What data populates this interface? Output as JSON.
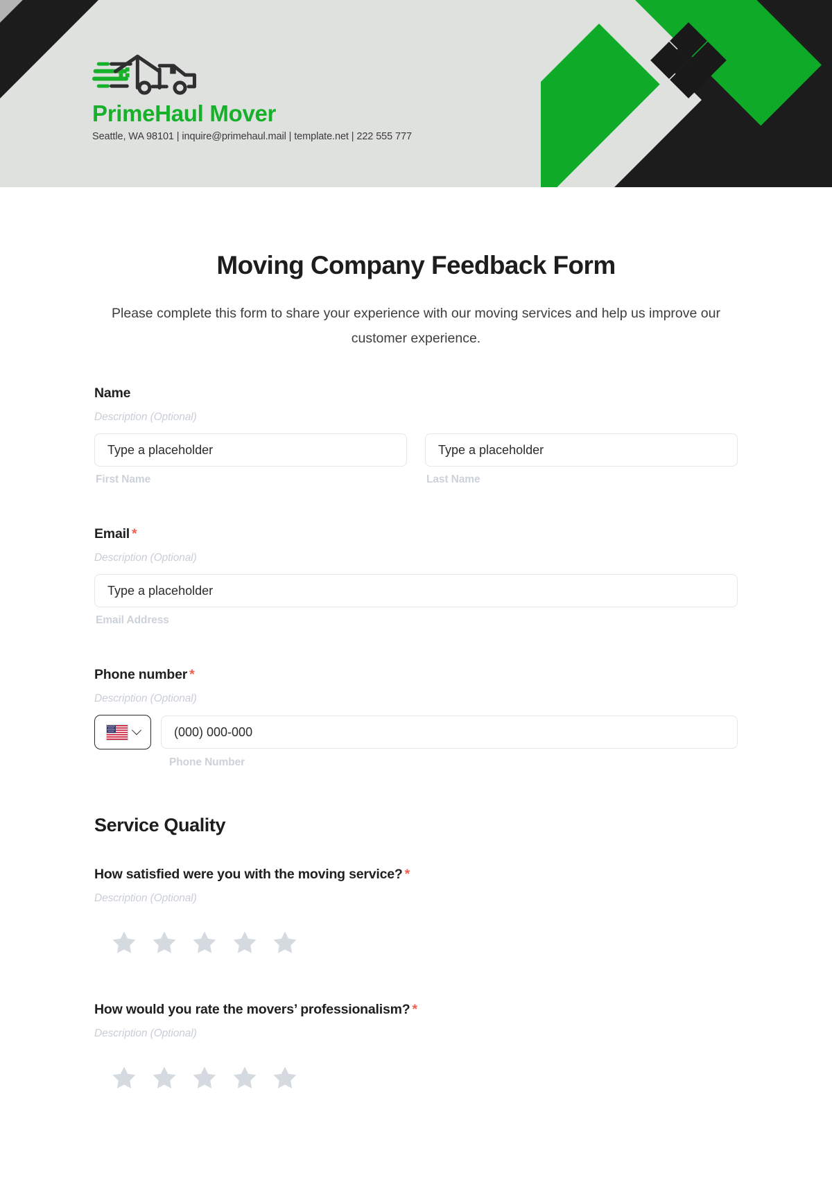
{
  "header": {
    "brand_name": "PrimeHaul Mover",
    "contact_line": "Seattle, WA 98101 | inquire@primehaul.mail | template.net | 222 555 777",
    "logo_icon": "moving-truck-icon",
    "accent_green": "#0fab28",
    "dark": "#1c1c1c",
    "banner_bg": "#dfe1df"
  },
  "form": {
    "title": "Moving Company Feedback Form",
    "subtitle": "Please complete this form to share your experience with our moving services and help us improve our customer experience.",
    "required_marker": "*",
    "description_placeholder": "Description (Optional)",
    "fields": {
      "name": {
        "label": "Name",
        "description": "Description (Optional)",
        "first": {
          "placeholder": "Type a placeholder",
          "sub_label": "First Name"
        },
        "last": {
          "placeholder": "Type a placeholder",
          "sub_label": "Last Name"
        }
      },
      "email": {
        "label": "Email",
        "required": "*",
        "description": "Description (Optional)",
        "placeholder": "Type a placeholder",
        "sub_label": "Email Address"
      },
      "phone": {
        "label": "Phone number",
        "required": "*",
        "description": "Description (Optional)",
        "country_flag": "us-flag-icon",
        "placeholder": "(000) 000-000",
        "sub_label": "Phone Number"
      }
    },
    "sections": [
      {
        "heading": "Service Quality",
        "questions": [
          {
            "label": "How satisfied were you with the moving service?",
            "required": "*",
            "description": "Description (Optional)",
            "type": "star-rating",
            "star_count": 5,
            "selected": 0,
            "star_color": "#d5dae0"
          },
          {
            "label": "How would you rate the movers’ professionalism?",
            "required": "*",
            "description": "Description (Optional)",
            "type": "star-rating",
            "star_count": 5,
            "selected": 0,
            "star_color": "#d5dae0"
          }
        ]
      }
    ]
  }
}
